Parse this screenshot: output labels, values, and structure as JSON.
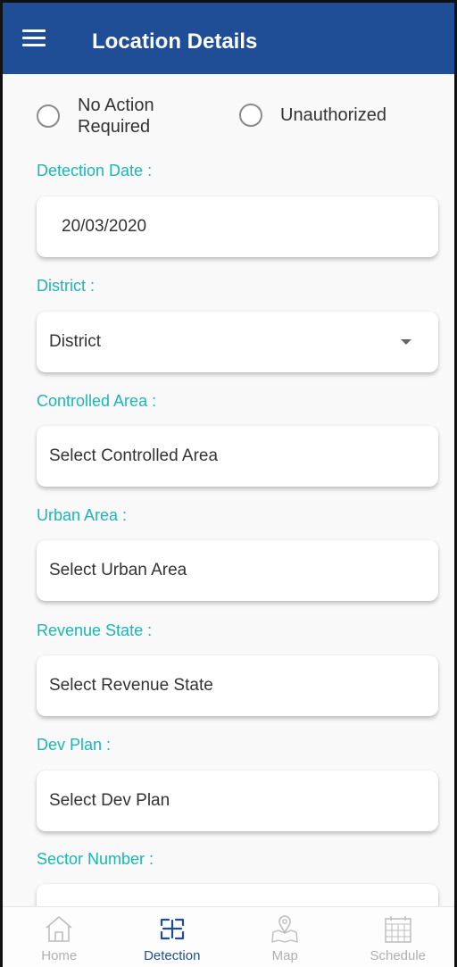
{
  "appbar": {
    "title": "Location Details",
    "menu_icon": "hamburger-menu-icon"
  },
  "status_options": [
    {
      "label_line1": "No Action",
      "label_line2": "Required",
      "selected": false
    },
    {
      "label": "Unauthorized",
      "selected": false
    }
  ],
  "fields": {
    "detection_date": {
      "label": "Detection Date :",
      "value": "20/03/2020"
    },
    "district": {
      "label": "District :",
      "value": "District"
    },
    "controlled_area": {
      "label": "Controlled Area :",
      "placeholder": "Select Controlled Area"
    },
    "urban_area": {
      "label": "Urban Area :",
      "placeholder": "Select Urban Area"
    },
    "revenue_state": {
      "label": "Revenue State :",
      "placeholder": "Select Revenue State"
    },
    "dev_plan": {
      "label": "Dev Plan :",
      "placeholder": "Select Dev Plan"
    },
    "sector_number": {
      "label": "Sector Number :"
    }
  },
  "bottom_nav": [
    {
      "label": "Home",
      "icon": "home-icon",
      "active": false
    },
    {
      "label": "Detection",
      "icon": "scan-icon",
      "active": true
    },
    {
      "label": "Map",
      "icon": "map-pin-icon",
      "active": false
    },
    {
      "label": "Schedule",
      "icon": "calendar-icon",
      "active": false
    }
  ],
  "colors": {
    "primary": "#1f4e97",
    "label_teal": "#1bb6b6",
    "inactive_nav": "#b0b0b0"
  }
}
